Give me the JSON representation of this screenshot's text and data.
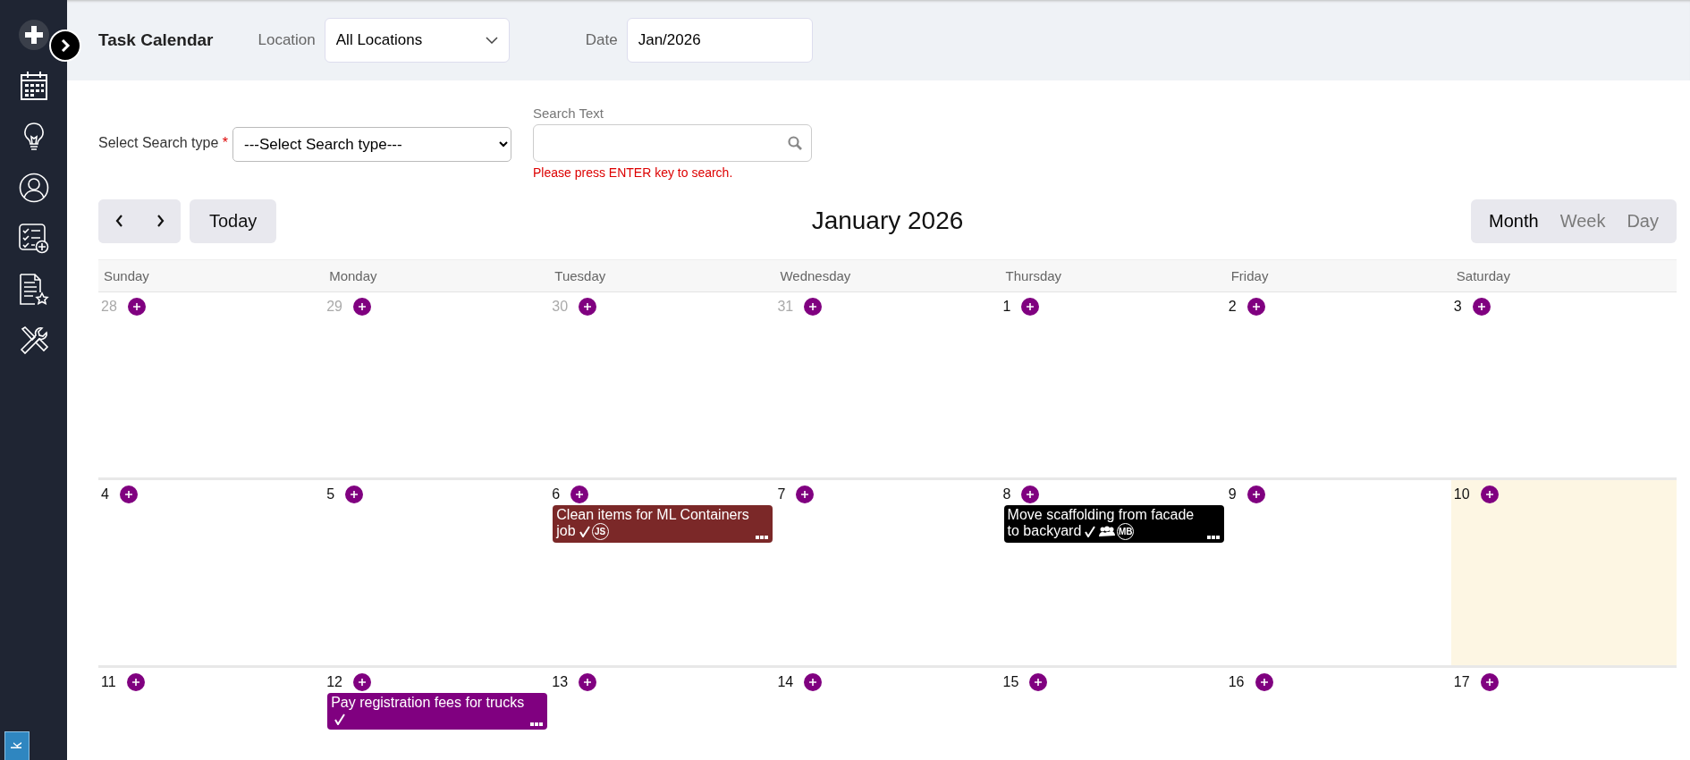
{
  "sidebar": {
    "items": [
      {
        "kind": "plus"
      },
      {
        "kind": "calendar"
      },
      {
        "kind": "bulb"
      },
      {
        "kind": "user"
      },
      {
        "kind": "checklist"
      },
      {
        "kind": "document"
      },
      {
        "kind": "tools"
      }
    ],
    "tab_label": "k"
  },
  "header": {
    "title": "Task Calendar",
    "location_label": "Location",
    "location_value": "All Locations",
    "date_label": "Date",
    "date_value": "Jan/2026"
  },
  "search": {
    "type_label": "Select Search type",
    "required_mark": "*",
    "type_value": "---Select Search type---",
    "text_label": "Search Text",
    "hint": "Please press ENTER key to search."
  },
  "toolbar": {
    "today": "Today",
    "title": "January 2026",
    "views": [
      {
        "label": "Month",
        "selected": true
      },
      {
        "label": "Week",
        "selected": false
      },
      {
        "label": "Day",
        "selected": false
      }
    ]
  },
  "weekdays": [
    "Sunday",
    "Monday",
    "Tuesday",
    "Wednesday",
    "Thursday",
    "Friday",
    "Saturday"
  ],
  "weeks": [
    {
      "days": [
        {
          "day": "28",
          "muted": true,
          "today": false
        },
        {
          "day": "29",
          "muted": true,
          "today": false
        },
        {
          "day": "30",
          "muted": true,
          "today": false
        },
        {
          "day": "31",
          "muted": true,
          "today": false
        },
        {
          "day": "1",
          "muted": false,
          "today": false
        },
        {
          "day": "2",
          "muted": false,
          "today": false
        },
        {
          "day": "3",
          "muted": false,
          "today": false
        }
      ]
    },
    {
      "days": [
        {
          "day": "4",
          "muted": false,
          "today": false
        },
        {
          "day": "5",
          "muted": false,
          "today": false
        },
        {
          "day": "6",
          "muted": false,
          "today": false,
          "events": [
            {
              "title": "Clean items for ML Containers job",
              "color": "#7b2828",
              "done": true,
              "group": false,
              "assignee": "JS"
            }
          ]
        },
        {
          "day": "7",
          "muted": false,
          "today": false
        },
        {
          "day": "8",
          "muted": false,
          "today": false,
          "events": [
            {
              "title": "Move scaffolding from facade to backyard",
              "color": "#000000",
              "done": true,
              "group": true,
              "assignee": "MB"
            }
          ]
        },
        {
          "day": "9",
          "muted": false,
          "today": false
        },
        {
          "day": "10",
          "muted": false,
          "today": true
        }
      ]
    },
    {
      "days": [
        {
          "day": "11",
          "muted": false,
          "today": false
        },
        {
          "day": "12",
          "muted": false,
          "today": false,
          "events": [
            {
              "title": "Pay registration fees for trucks",
              "color": "#800080",
              "done": true,
              "group": false
            }
          ]
        },
        {
          "day": "13",
          "muted": false,
          "today": false
        },
        {
          "day": "14",
          "muted": false,
          "today": false
        },
        {
          "day": "15",
          "muted": false,
          "today": false
        },
        {
          "day": "16",
          "muted": false,
          "today": false
        },
        {
          "day": "17",
          "muted": false,
          "today": false
        }
      ]
    }
  ]
}
